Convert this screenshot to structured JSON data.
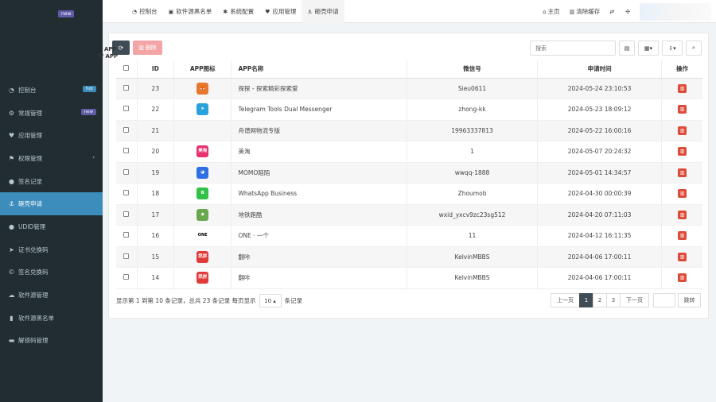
{
  "sidebar": {
    "top_badge": "new",
    "items": [
      {
        "icon": "dashboard-icon",
        "glyph": "◔",
        "label": "控制台",
        "badge": "hot",
        "badge_type": "hot"
      },
      {
        "icon": "cogs-icon",
        "glyph": "⚙",
        "label": "常规管理",
        "badge": "new",
        "badge_type": "new"
      },
      {
        "icon": "heart-icon",
        "glyph": "♥",
        "label": "应用管理",
        "badge": "",
        "badge_type": ""
      },
      {
        "icon": "group-icon",
        "glyph": "⚑",
        "label": "权限管理",
        "badge": "",
        "badge_type": "",
        "chevron": "‹"
      },
      {
        "icon": "circle-icon",
        "glyph": "●",
        "label": "签名记录",
        "badge": "",
        "badge_type": ""
      },
      {
        "icon": "anchor-icon",
        "glyph": "⚓",
        "label": "砸壳申请",
        "badge": "",
        "badge_type": "",
        "active": true
      },
      {
        "icon": "apple-icon",
        "glyph": "●",
        "label": "UDID管理",
        "badge": "",
        "badge_type": ""
      },
      {
        "icon": "send-icon",
        "glyph": "➤",
        "label": "证书兑换码",
        "badge": "",
        "badge_type": ""
      },
      {
        "icon": "copyright-icon",
        "glyph": "©",
        "label": "签名兑换码",
        "badge": "",
        "badge_type": ""
      },
      {
        "icon": "cloud-icon",
        "glyph": "☁",
        "label": "软件源管理",
        "badge": "",
        "badge_type": ""
      },
      {
        "icon": "bookmark-icon",
        "glyph": "▮",
        "label": "软件源黑名单",
        "badge": "",
        "badge_type": ""
      },
      {
        "icon": "keyboard-icon",
        "glyph": "▬",
        "label": "解锁码管理",
        "badge": "",
        "badge_type": ""
      }
    ]
  },
  "topnav": {
    "tabs": [
      {
        "icon": "dashboard-icon",
        "glyph": "◔",
        "label": "控制台"
      },
      {
        "icon": "book-icon",
        "glyph": "▣",
        "label": "软件源黑名单"
      },
      {
        "icon": "cog-icon",
        "glyph": "✱",
        "label": "系统配置"
      },
      {
        "icon": "heart-icon",
        "glyph": "♥",
        "label": "应用管理"
      },
      {
        "icon": "anchor-icon",
        "glyph": "⚓",
        "label": "砸壳申请",
        "active": true
      }
    ],
    "home_label": "主页",
    "clear_cache_label": "清除缓存"
  },
  "toolbar": {
    "overlay_line1": "APP",
    "overlay_prefix": "常",
    "overlay_line2": "APP",
    "delete_label": "删除",
    "search_placeholder": "搜索"
  },
  "table": {
    "headers": {
      "id": "ID",
      "icon": "APP图标",
      "name": "APP名称",
      "wechat": "微信号",
      "time": "申请时间",
      "op": "操作"
    },
    "rows": [
      {
        "id": "23",
        "icon": "fox-app-icon",
        "icon_color": "#e8772e",
        "icon_text": "🦊",
        "name": "探探 - 探索精彩探索爱",
        "wechat": "Sieu0611",
        "time": "2024-05-24 23:10:53"
      },
      {
        "id": "22",
        "icon": "telegram-app-icon",
        "icon_color": "#2aa3dd",
        "icon_text": "➤",
        "name": "Telegram Tools Dual Messenger",
        "wechat": "zhong-kk",
        "time": "2024-05-23 18:09:12"
      },
      {
        "id": "21",
        "icon": "",
        "icon_color": "",
        "icon_text": "",
        "name": "舟谱网物流专版",
        "wechat": "19963337813",
        "time": "2024-05-22 16:00:16"
      },
      {
        "id": "20",
        "icon": "meitao-app-icon",
        "icon_color": "#e8316e",
        "icon_text": "美淘",
        "name": "美淘",
        "wechat": "1",
        "time": "2024-05-07 20:24:32"
      },
      {
        "id": "19",
        "icon": "momo-app-icon",
        "icon_color": "#2f6fe4",
        "icon_text": "◕",
        "name": "MOMO陌陌",
        "wechat": "wwqq-1888",
        "time": "2024-05-01 14:34:57"
      },
      {
        "id": "18",
        "icon": "whatsapp-app-icon",
        "icon_color": "#31c149",
        "icon_text": "B",
        "name": "WhatsApp Business",
        "wechat": "Zhoumob",
        "time": "2024-04-30 00:00:39"
      },
      {
        "id": "17",
        "icon": "subway-app-icon",
        "icon_color": "#6aa84f",
        "icon_text": "◆",
        "name": "地铁跑酷",
        "wechat": "wxid_yxcv9zc23sg512",
        "time": "2024-04-20 07:11:03"
      },
      {
        "id": "16",
        "icon": "one-app-icon",
        "icon_color": "#ffffff",
        "icon_text": "ONE",
        "name": "ONE · 一个",
        "wechat": "11",
        "time": "2024-04-12 16:11:35"
      },
      {
        "id": "15",
        "icon": "xunpin-app-icon",
        "icon_color": "#e03a3a",
        "icon_text": "訊拼",
        "name": "翻咔",
        "wechat": "KelvinMBBS",
        "time": "2024-04-06 17:00:11"
      },
      {
        "id": "14",
        "icon": "xunpin-app-icon",
        "icon_color": "#e03a3a",
        "icon_text": "訊拼",
        "name": "翻咔",
        "wechat": "KelvinMBBS",
        "time": "2024-04-06 17:00:11"
      }
    ]
  },
  "footer": {
    "info_text": "显示第 1 到第 10 条记录，总共 23 条记录 每页显示",
    "page_size": "10 ▴",
    "info_suffix": "条记录",
    "prev_label": "上一页",
    "pages": [
      "1",
      "2",
      "3"
    ],
    "next_label": "下一页",
    "jump_label": "跳转"
  },
  "colors": {
    "sidebar_bg": "#222d32",
    "active_blue": "#3c8dbc",
    "delete_red": "#dd4b39"
  }
}
